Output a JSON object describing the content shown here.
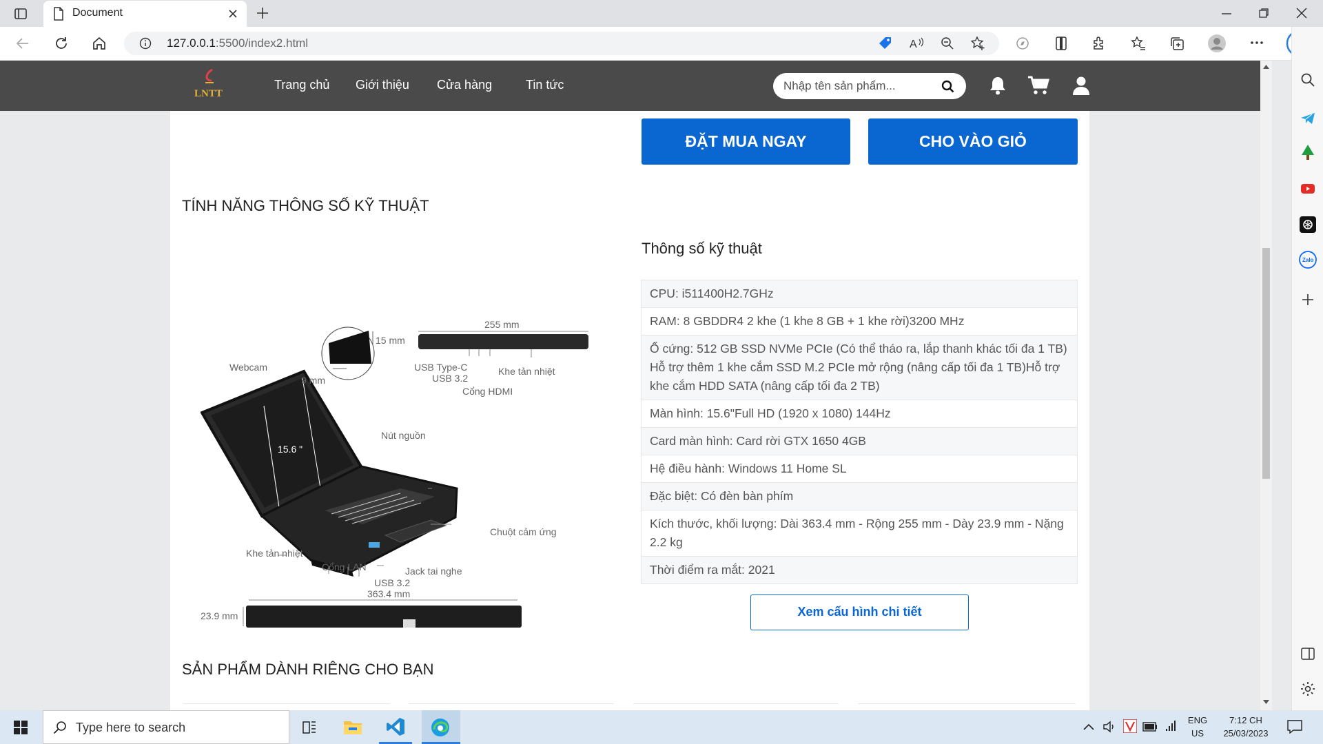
{
  "browser": {
    "tab_title": "Document",
    "url_host": "127.0.0.1",
    "url_rest": ":5500/index2.html"
  },
  "site": {
    "logo_text": "LNTT",
    "nav": [
      "Trang chủ",
      "Giới thiệu",
      "Cửa hàng",
      "Tin tức"
    ],
    "search_placeholder": "Nhập tên sản phẩm..."
  },
  "product": {
    "buy_now": "ĐẶT MUA NGAY",
    "add_to_cart": "CHO VÀO GIỎ",
    "features_title": "TÍNH NĂNG THÔNG SỐ KỸ THUẬT",
    "specs_title": "Thông số kỹ thuật",
    "specs": [
      "CPU: i511400H2.7GHz",
      "RAM: 8 GBDDR4 2 khe (1 khe 8 GB + 1 khe rời)3200 MHz",
      "Ổ cứng: 512 GB SSD NVMe PCIe (Có thể tháo ra, lắp thanh khác tối đa 1 TB) Hỗ trợ thêm 1 khe cắm SSD M.2 PCIe mở rộng (nâng cấp tối đa 1 TB)Hỗ trợ khe cắm HDD SATA (nâng cấp tối đa 2 TB)",
      "Màn hình: 15.6\"Full HD (1920 x 1080) 144Hz",
      "Card màn hình: Card rời GTX 1650 4GB",
      "Hệ điều hành: Windows 11 Home SL",
      "Đặc biệt: Có đèn bàn phím",
      "Kích thước, khối lượng: Dài 363.4 mm - Rộng 255 mm - Dày 23.9 mm - Nặng 2.2 kg",
      "Thời điểm ra mắt: 2021"
    ],
    "detail_button": "Xem cấu hình chi tiết",
    "recommend_title": "SẢN PHẨM DÀNH RIÊNG CHO BẠN",
    "diagram_labels": {
      "webcam": "Webcam",
      "h15": "15 mm",
      "w9": "9 mm",
      "screen": "15.6 \"",
      "power": "Nút nguồn",
      "vent_left": "Khe tản nhiệt",
      "lan": "Cổng LAN",
      "usb32_bottom": "USB 3.2",
      "jack": "Jack tai nghe",
      "touchpad": "Chuột cảm ứng",
      "width255": "255 mm",
      "usbc": "USB Type-C",
      "usb32_side": "USB 3.2",
      "hdmi": "Cổng HDMI",
      "vent_side": "Khe tản nhiệt",
      "length": "363.4 mm",
      "thickness": "23.9 mm"
    }
  },
  "taskbar": {
    "search_placeholder": "Type here to search",
    "lang_top": "ENG",
    "lang_bottom": "US",
    "time": "7:12 CH",
    "date": "25/03/2023"
  },
  "colors": {
    "nav_bg": "#4a4a4a",
    "primary": "#0a66d0",
    "logo_accent": "#e0424b"
  },
  "icons": {
    "sidebar": [
      "search-icon",
      "telegram-icon",
      "tree-icon",
      "youtube-icon",
      "chatgpt-icon",
      "zalo-icon",
      "plus-icon"
    ]
  }
}
